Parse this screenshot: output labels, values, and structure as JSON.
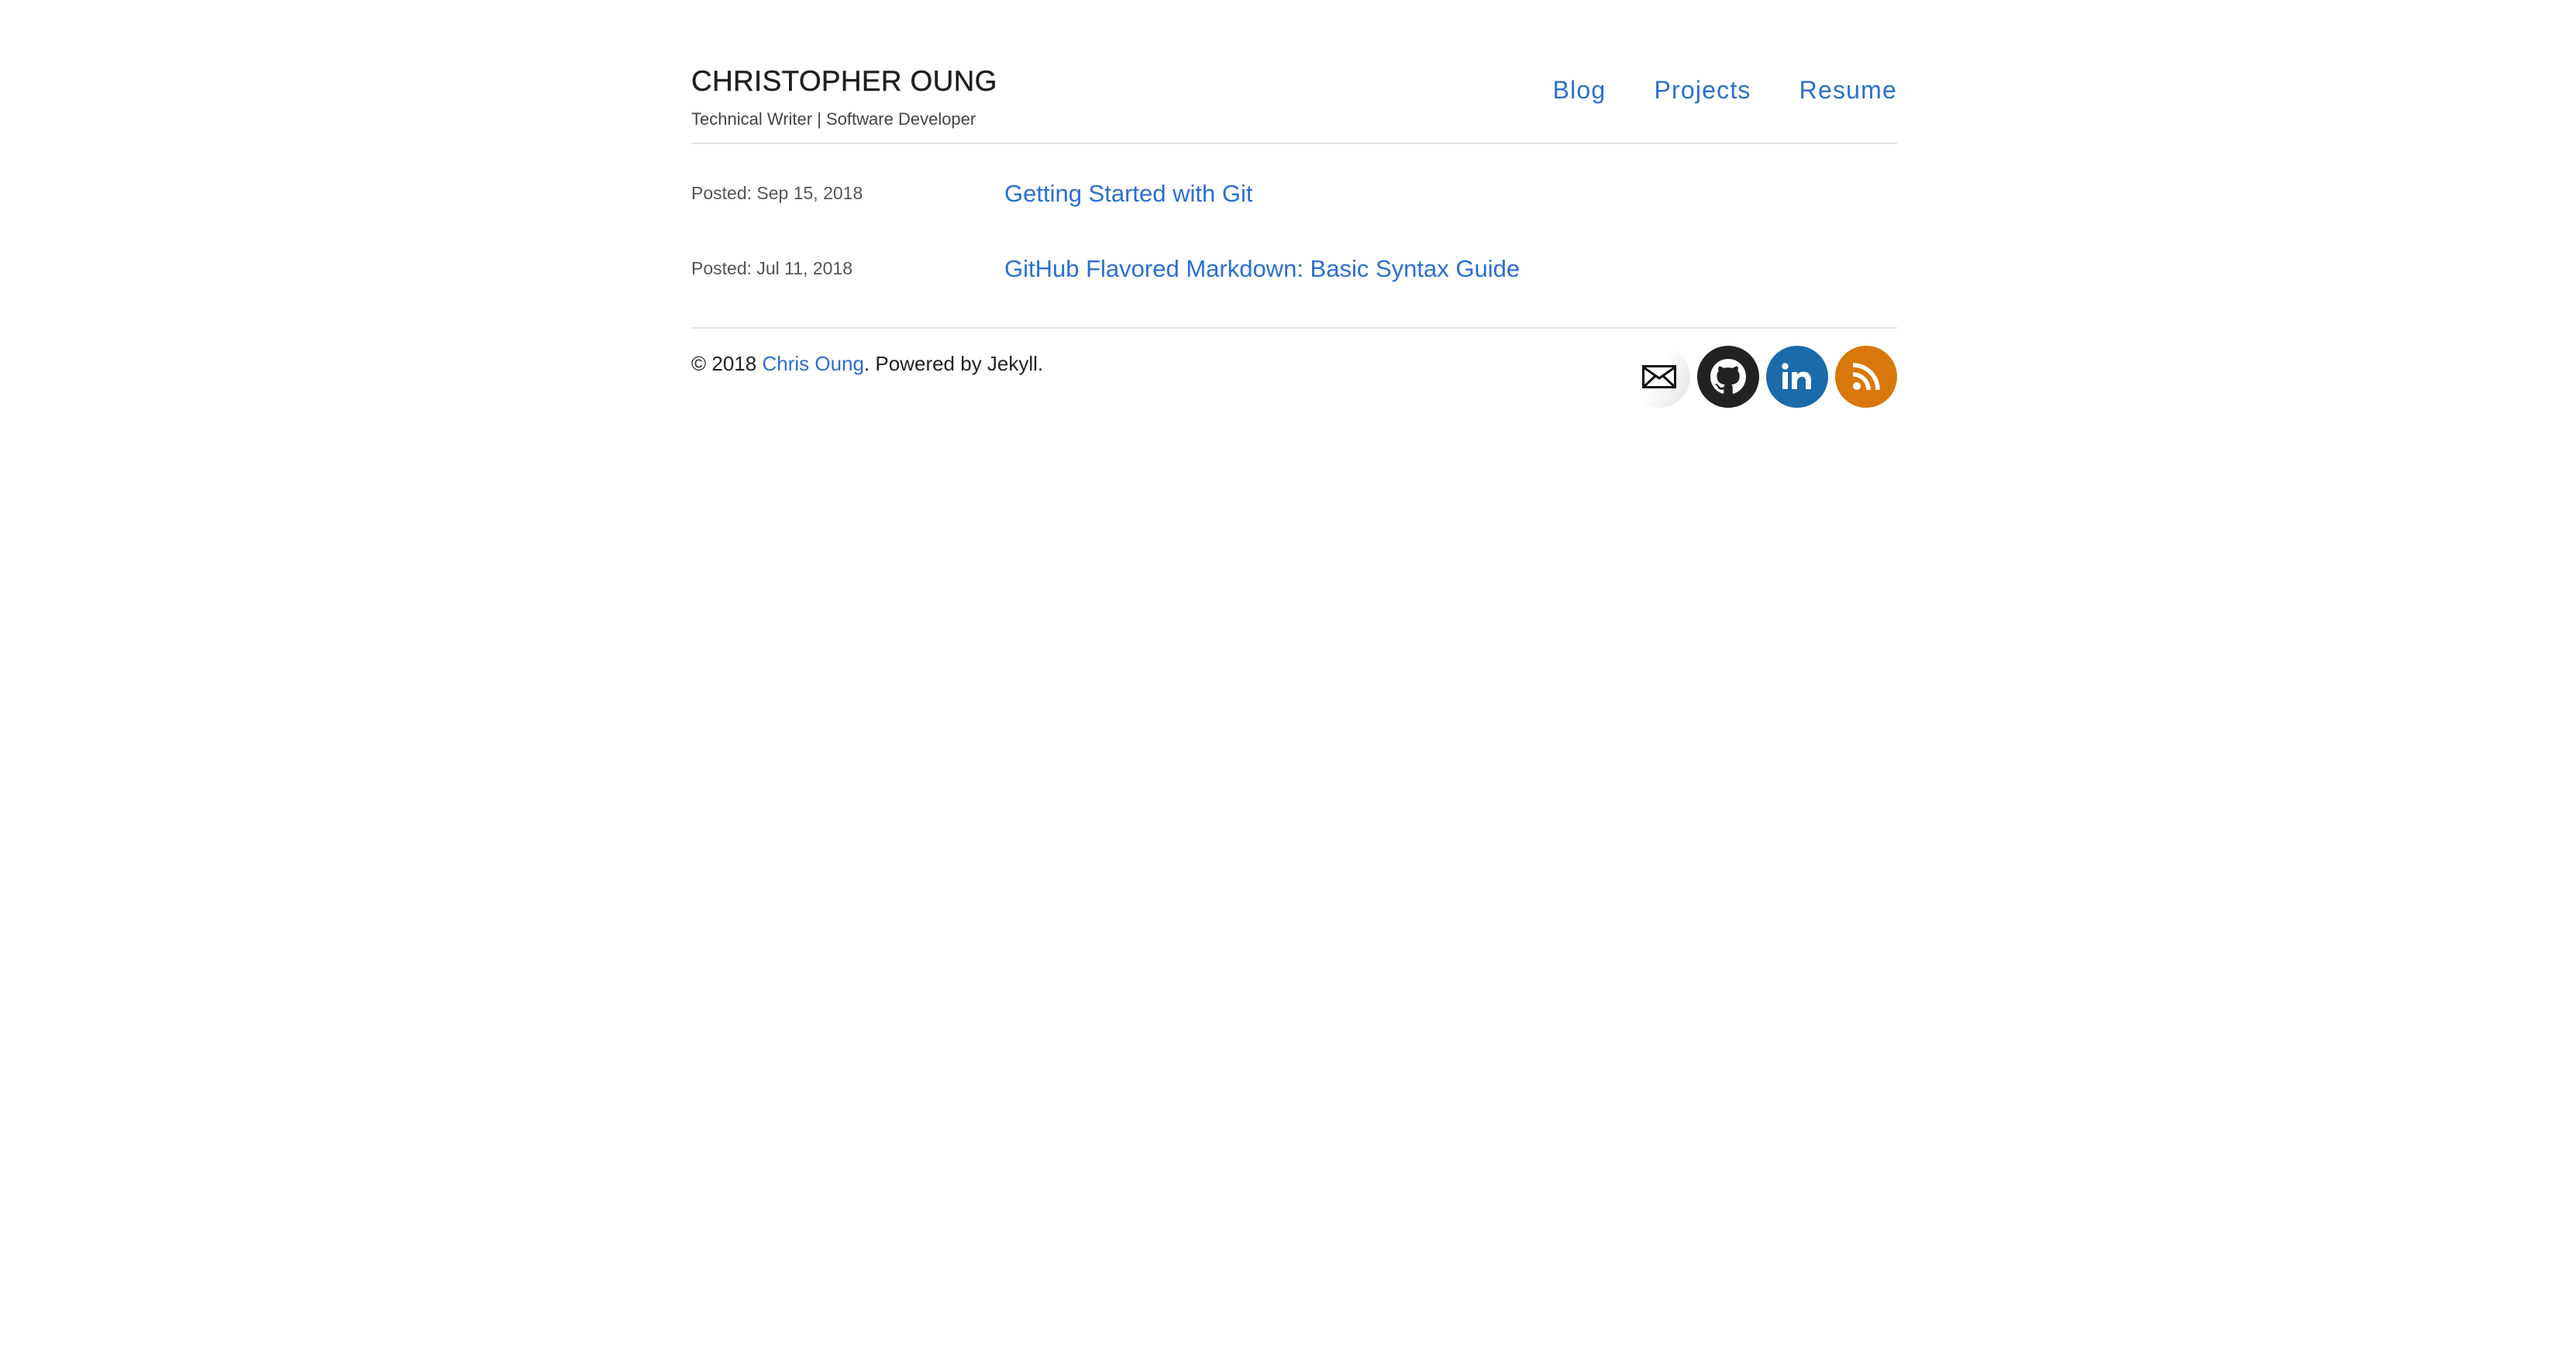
{
  "header": {
    "title": "CHRISTOPHER OUNG",
    "tagline": "Technical Writer | Software Developer",
    "nav": [
      {
        "label": "Blog"
      },
      {
        "label": "Projects"
      },
      {
        "label": "Resume"
      }
    ]
  },
  "posts": [
    {
      "date": "Posted: Sep 15, 2018",
      "title": "Getting Started with Git"
    },
    {
      "date": "Posted: Jul 11, 2018",
      "title": "GitHub Flavored Markdown: Basic Syntax Guide"
    }
  ],
  "footer": {
    "copyright_prefix": "© 2018 ",
    "author_link": "Chris Oung",
    "powered_by": ". Powered by Jekyll.",
    "social": [
      {
        "name": "email",
        "icon": "envelope-icon",
        "color": "#ffffff"
      },
      {
        "name": "github",
        "icon": "github-icon",
        "color": "#222222"
      },
      {
        "name": "linkedin",
        "icon": "linkedin-icon",
        "color": "#1b6aaa"
      },
      {
        "name": "rss",
        "icon": "rss-icon",
        "color": "#d8780b"
      }
    ]
  },
  "colors": {
    "link": "#2a6fd1",
    "text": "#222222",
    "divider": "#e6e6e6"
  }
}
